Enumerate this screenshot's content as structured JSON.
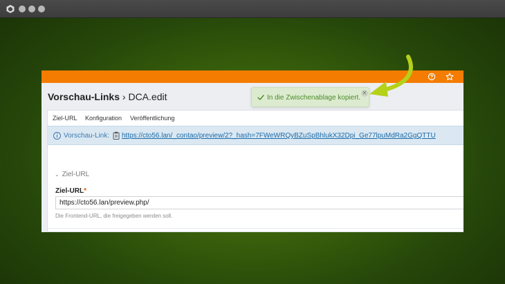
{
  "window": {
    "traffic_lights": [
      "close",
      "minimize",
      "maximize"
    ],
    "logo_icon": "contao-logo-icon"
  },
  "topbar": {
    "color": "#f47c00",
    "icons": [
      "help-icon",
      "star-icon"
    ]
  },
  "headline": {
    "section": "Vorschau-Links",
    "separator": "›",
    "action": "DCA.edit"
  },
  "tabs": [
    {
      "label": "Ziel-URL"
    },
    {
      "label": "Konfiguration"
    },
    {
      "label": "Veröffentlichung"
    }
  ],
  "info": {
    "label": "Vorschau-Link:",
    "url": "https://cto56.lan/_contao/preview/2?_hash=7FWeWRQyBZuSpBhlukX32Dpi_Ge77lpuMdRa2GgQTTU",
    "icon": "info-icon",
    "copy_icon": "clipboard-icon"
  },
  "fieldset": {
    "legend": "Ziel-URL",
    "field_label": "Ziel-URL",
    "required_mark": "*",
    "value": "https://cto56.lan/preview.php/",
    "help": "Die Frontend-URL, die freigegeben werden soll."
  },
  "toast": {
    "message": "In die Zwischenablage kopiert.",
    "icon": "check-icon",
    "close_icon": "close-icon",
    "color": "#4e8a2c"
  },
  "annotation": {
    "icon": "arrow-icon",
    "color": "#b5d119"
  }
}
